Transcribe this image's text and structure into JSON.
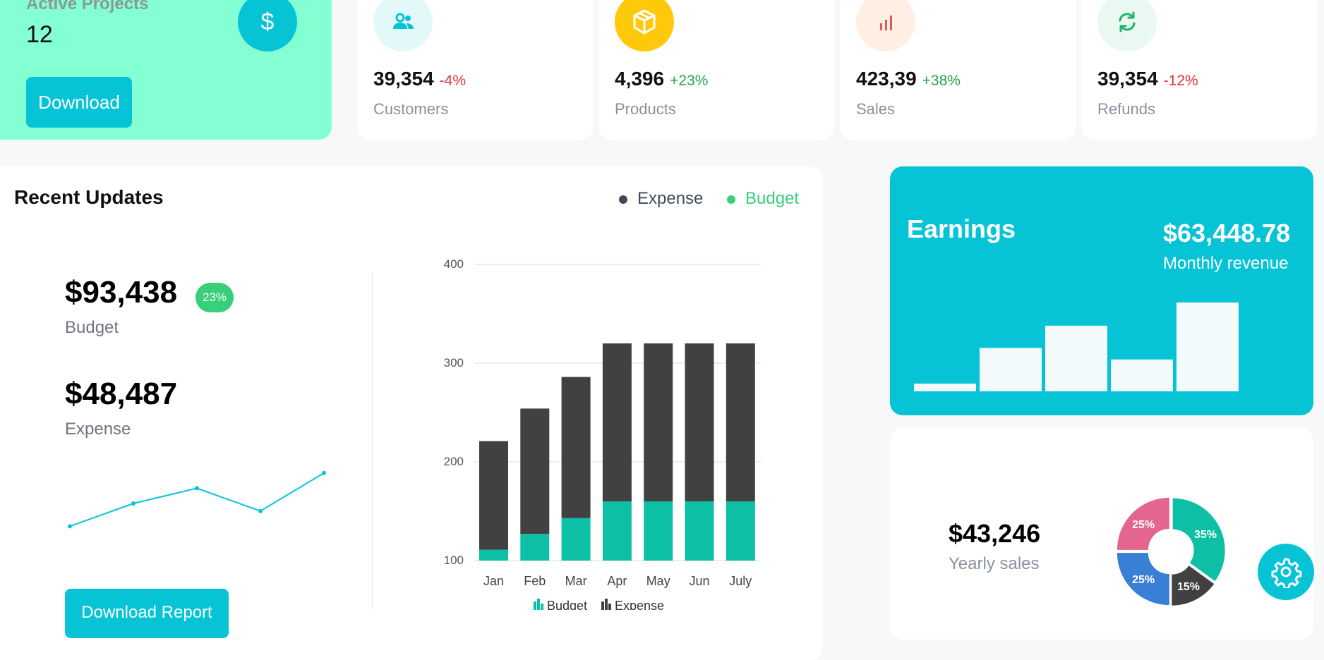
{
  "colors": {
    "teal": "#06c4d6",
    "mint": "#84ffd4",
    "dark": "#414141",
    "green": "#0cbfa5",
    "pink": "#e4668f",
    "blue": "#3a7fd6"
  },
  "active": {
    "title": "Active Projects",
    "count": "12",
    "download_label": "Download",
    "icon": "dollar-icon",
    "icon_glyph": "$"
  },
  "stats": [
    {
      "value": "39,354",
      "change": "-4%",
      "label": "Customers",
      "icon": "users-icon"
    },
    {
      "value": "4,396",
      "change": "+23%",
      "label": "Products",
      "icon": "box-icon"
    },
    {
      "value": "423,39",
      "change": "+38%",
      "label": "Sales",
      "icon": "bar-chart-icon"
    },
    {
      "value": "39,354",
      "change": "-12%",
      "label": "Refunds",
      "icon": "refresh-icon"
    }
  ],
  "updates": {
    "title": "Recent Updates",
    "legend": [
      {
        "label": "Expense",
        "color": "#414a5a"
      },
      {
        "label": "Budget",
        "color": "#37cf77"
      }
    ],
    "budget_value": "$93,438",
    "budget_badge": "23%",
    "budget_label": "Budget",
    "expense_value": "$48,487",
    "expense_label": "Expense",
    "report_button": "Download Report"
  },
  "earnings": {
    "title": "Earnings",
    "value": "$63,448.78",
    "subtitle": "Monthly revenue"
  },
  "yearly": {
    "value": "$43,246",
    "label": "Yearly sales"
  },
  "chart_data": [
    {
      "type": "line",
      "values": [
        0,
        1,
        2,
        3,
        4
      ],
      "y": [
        2,
        5,
        7,
        4,
        9
      ]
    },
    {
      "type": "bar",
      "stacked": true,
      "categories": [
        "Jan",
        "Feb",
        "Mar",
        "Apr",
        "May",
        "Jun",
        "July"
      ],
      "series": [
        {
          "name": "Budget",
          "values": [
            111,
            127,
            143,
            160,
            160,
            160,
            160
          ]
        },
        {
          "name": "Expense",
          "values": [
            110,
            127,
            143,
            160,
            160,
            160,
            160
          ]
        }
      ],
      "ylim": [
        100,
        400
      ],
      "yticks": [
        100,
        200,
        300,
        400
      ],
      "legend": [
        "Budget",
        "Expense"
      ],
      "legend_position": "bottom",
      "grid": true
    },
    {
      "type": "bar",
      "values": [
        8,
        45,
        68,
        33,
        92
      ]
    },
    {
      "type": "pie",
      "donut": true,
      "slices": [
        {
          "label": "35%",
          "value": 35,
          "color": "#0cbfa5"
        },
        {
          "label": "15%",
          "value": 15,
          "color": "#414141"
        },
        {
          "label": "25%",
          "value": 25,
          "color": "#3a7fd6"
        },
        {
          "label": "25%",
          "value": 25,
          "color": "#e4668f"
        }
      ]
    }
  ]
}
